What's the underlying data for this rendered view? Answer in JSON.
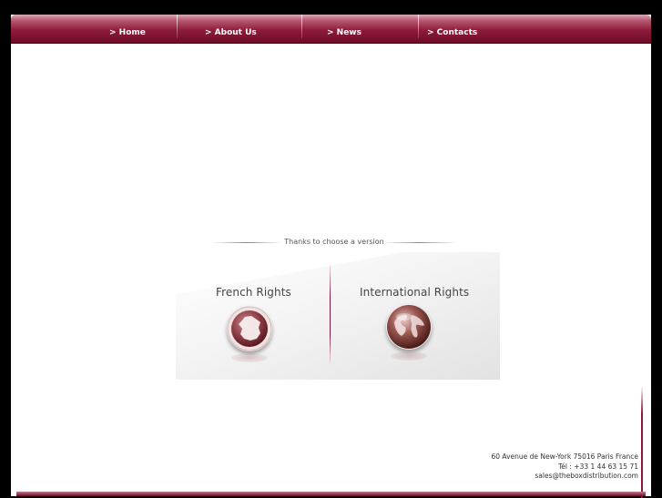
{
  "nav": {
    "items": [
      {
        "label": "> Home"
      },
      {
        "label": "> About Us"
      },
      {
        "label": "> News"
      },
      {
        "label": "> Contacts"
      }
    ]
  },
  "chooser": {
    "prompt": "Thanks to choose a version",
    "french": {
      "title": "French Rights",
      "icon": "france-map-icon"
    },
    "international": {
      "title": "International Rights",
      "icon": "globe-icon"
    }
  },
  "footer": {
    "address": "60 Avenue de New-York 75016 Paris France",
    "phone": "Tél : +33 1 44 63 15 71",
    "email": "sales@theboxdistribution.com"
  },
  "colors": {
    "brand": "#8a1639",
    "background": "#000000"
  }
}
